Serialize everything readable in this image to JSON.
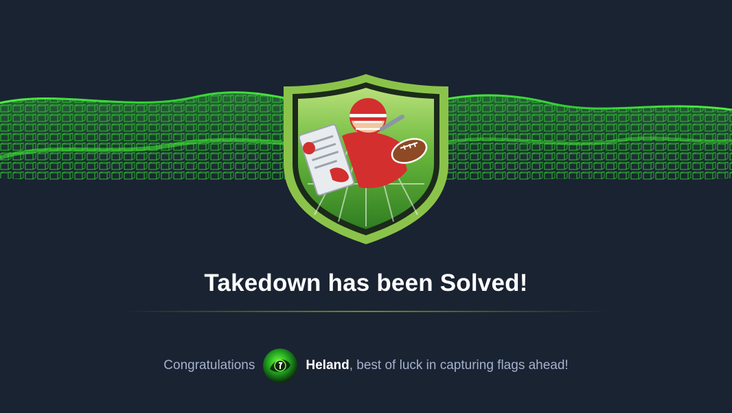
{
  "machine": {
    "name": "Takedown",
    "title": "Takedown has been Solved!"
  },
  "congrats": {
    "lead": "Congratulations",
    "username": "Heland",
    "tail": ", best of luck in capturing flags ahead!"
  },
  "badge": {
    "icon": "football-player-shield-badge-icon"
  },
  "avatar": {
    "icon": "user-avatar-icon"
  },
  "colors": {
    "background": "#1a2332",
    "accent_green": "#9fef00",
    "badge_green": "#8bc34a",
    "text_muted": "#a4b1cd",
    "text_white": "#ffffff"
  }
}
